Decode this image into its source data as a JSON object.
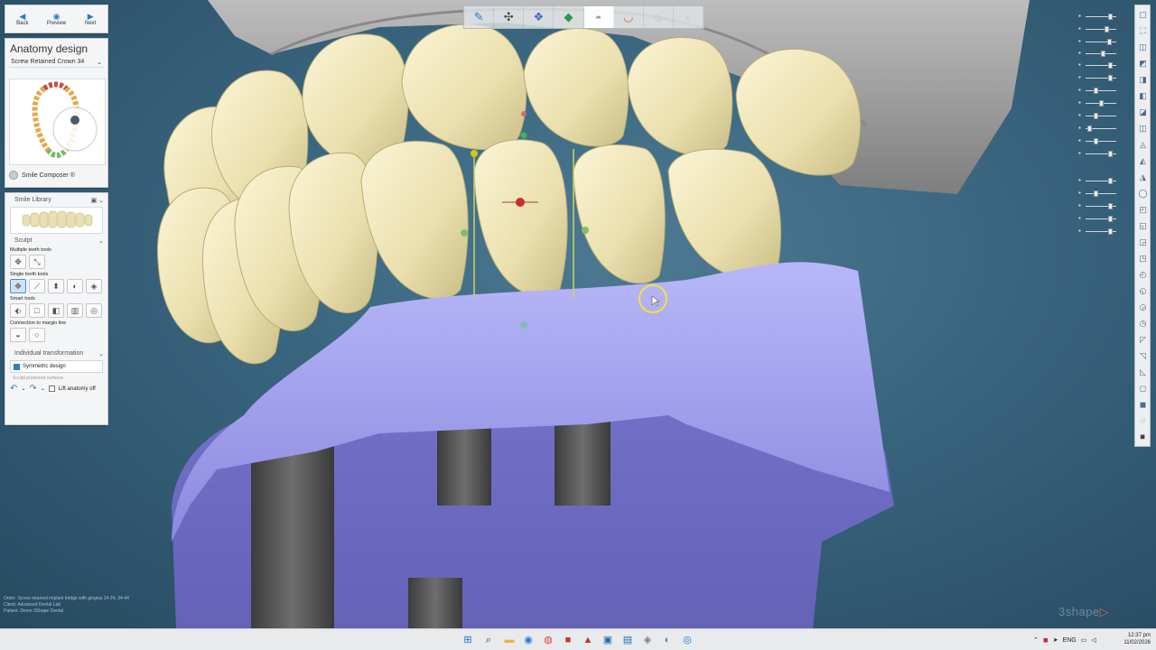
{
  "navigation": {
    "back": "Back",
    "preview": "Preview",
    "next": "Next"
  },
  "anatomy": {
    "title": "Anatomy design",
    "crown_type": "Screw Retained Crown 34",
    "smile_composer": "Smile Composer ®"
  },
  "tools": {
    "smile_library": "Smile Library",
    "sculpt": "Sculpt",
    "multiple_teeth": "Multiple teeth tools",
    "single_tooth": "Single tooth tools",
    "smart_tools": "Smart tools",
    "connection_margin": "Connection to margin line",
    "individual_transformation": "Individual transformation",
    "symmetric_design": "Symmetric design",
    "symmetric_checked": true,
    "sculpt_protected": "Sculpt protected surfaces",
    "lift_anatomy_off": "Lift anatomy off"
  },
  "colors": {
    "accent": "#2a7ec4",
    "tooth": "#ede3b5",
    "gingiva": "#a7a6f0",
    "stone": "#9c9c9c",
    "background": "#3a6680",
    "logo_mark": "#c8675f"
  },
  "top_toolbar_icons": [
    "pencil-icon",
    "expand-arrows-icon",
    "layers-icon",
    "gem-icon",
    "tooth-icon",
    "smile-icon",
    "tooth-outline-icon",
    "blank-tool-icon"
  ],
  "sliders": [
    {
      "icon": "tooth-upper-icon",
      "value": 0.82
    },
    {
      "icon": "jaw-icon",
      "value": 0.7
    },
    {
      "icon": "gum-icon",
      "value": 0.8
    },
    {
      "icon": "model-icon",
      "value": 0.55
    },
    {
      "icon": "antagonist-icon",
      "value": 0.82
    },
    {
      "icon": "scan-icon",
      "value": 0.82
    },
    {
      "icon": "lower-icon",
      "value": 0.3
    },
    {
      "icon": "gold-tooth-icon",
      "value": 0.5
    },
    {
      "icon": "implant-icon",
      "value": 0.3
    },
    {
      "icon": "crown-icon",
      "value": 0.05
    },
    {
      "icon": "bite-icon",
      "value": 0.3
    },
    {
      "icon": "margin-icon",
      "value": 0.82
    },
    {
      "icon": "screw-icon",
      "value": 0.82
    },
    {
      "icon": "abutment-icon",
      "value": 0.3
    },
    {
      "icon": "green-icon",
      "value": 0.82
    },
    {
      "icon": "gray-icon",
      "value": 0.82
    },
    {
      "icon": "pen-icon",
      "value": 0.82
    }
  ],
  "info": {
    "order": "Order: ",
    "order_value": "Screw retained implant bridge with gingiva 14-24, 34-44",
    "client": "Client: ",
    "client_value": "Advanced Dental Lab",
    "patient": "Patient: ",
    "patient_value": "Demo 3Shape Dental"
  },
  "logo": {
    "text": "3shape",
    "mark": "▷"
  },
  "taskbar": {
    "lang": "ENG",
    "time": "12:37 pm",
    "date": "11/02/2026"
  }
}
